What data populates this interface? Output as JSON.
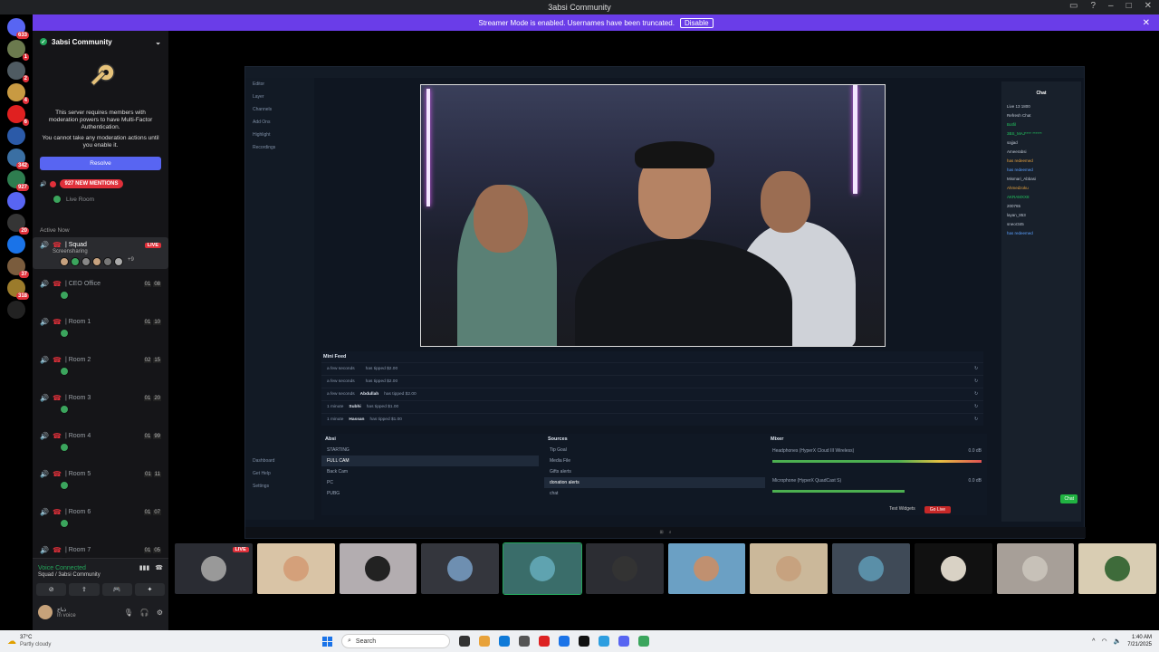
{
  "window": {
    "title": "3absi Community"
  },
  "banner": {
    "text": "Streamer Mode is enabled. Usernames have been truncated.",
    "disable_label": "Disable"
  },
  "guilds": [
    {
      "badge": "633",
      "color": "#5865f2"
    },
    {
      "badge": "1",
      "color": "#6b7a4e"
    },
    {
      "badge": "2",
      "color": "#4f5b62"
    },
    {
      "badge": "4",
      "color": "#c89a42"
    },
    {
      "badge": "6",
      "color": "#e02020"
    },
    {
      "badge": "",
      "color": "#2b5aa8"
    },
    {
      "badge": "342",
      "color": "#3a6fa3"
    },
    {
      "badge": "927",
      "color": "#2e7d4f"
    },
    {
      "badge": "",
      "color": "#5865f2"
    },
    {
      "badge": "20",
      "color": "#353535"
    },
    {
      "badge": "",
      "color": "#1a73e8"
    },
    {
      "badge": "37",
      "color": "#7a5c3d"
    },
    {
      "badge": "318",
      "color": "#9b7b2b"
    },
    {
      "badge": "",
      "color": "#222"
    }
  ],
  "server": {
    "name": "3absi Community",
    "mfa_text_1": "This server requires members with moderation powers to have Multi-Factor Authentication.",
    "mfa_text_2": "You cannot take any moderation actions until you enable it.",
    "resolve_label": "Resolve",
    "mentions_label": "927 NEW MENTIONS",
    "live_room": "Live Room",
    "active_now": "Active Now"
  },
  "channels": [
    {
      "name": "| Squad",
      "sub": "Screensharing",
      "live": "LIVE",
      "c1": "",
      "c2": "",
      "more": "+9"
    },
    {
      "name": "| CEO Office",
      "c1": "01",
      "c2": "08"
    },
    {
      "name": "| Room 1",
      "c1": "01",
      "c2": "10"
    },
    {
      "name": "| Room 2",
      "c1": "02",
      "c2": "15"
    },
    {
      "name": "| Room 3",
      "c1": "01",
      "c2": "20"
    },
    {
      "name": "| Room 4",
      "c1": "01",
      "c2": "99"
    },
    {
      "name": "| Room 5",
      "c1": "01",
      "c2": "11"
    },
    {
      "name": "| Room 6",
      "c1": "01",
      "c2": "07"
    },
    {
      "name": "| Room 7",
      "c1": "01",
      "c2": "05"
    }
  ],
  "voice": {
    "status": "Voice Connected",
    "channel": "Squad / 3absi Community",
    "user_name": "ذباح",
    "user_status": "In voice"
  },
  "obs": {
    "menu": [
      "Editor",
      "Layer",
      "Channels",
      "Add Ons",
      "Highlight",
      "Recordings"
    ],
    "minifeed_title": "Mini Feed",
    "feed": [
      {
        "time": "a few seconds",
        "user": "",
        "text": "has tipped $2.00"
      },
      {
        "time": "a few seconds",
        "user": "",
        "text": "has tipped $2.00"
      },
      {
        "time": "a few seconds",
        "user": "Abdullah",
        "text": "has tipped $2.00"
      },
      {
        "time": "1 minute",
        "user": "Subhi",
        "text": "has tipped $1.00"
      },
      {
        "time": "1 minute",
        "user": "Hassan",
        "text": "has tipped $1.00"
      }
    ],
    "scenes_title": "Absi",
    "scenes": [
      "STARTING",
      "FULL CAM",
      "Back Cam",
      "PC",
      "PUBG"
    ],
    "sources_title": "Sources",
    "sources": [
      "Tip Goal",
      "Media File",
      "Gifts alerts",
      "donation alerts",
      "chat"
    ],
    "mixer_title": "Mixer",
    "mixer": [
      {
        "name": "Headphones (HyperX Cloud III Wireless)",
        "db": "0.0 dB"
      },
      {
        "name": "Microphone (HyperX QuadCast S)",
        "db": "0.0 dB"
      }
    ],
    "bottom": [
      "Dashboard",
      "Get Help",
      "Settings"
    ],
    "test_widgets": "Test Widgets",
    "go_live": "Go Live",
    "chat_title": "Chat",
    "chat_btn": "Chat",
    "chat_lines": [
      {
        "t": "Live 13 1800",
        "c": ""
      },
      {
        "t": "Refresh Chat",
        "c": ""
      },
      {
        "t": "Botfil",
        "c": "g"
      },
      {
        "t": "3BS_MAJ**** ******",
        "c": "g"
      },
      {
        "t": "sajjad",
        "c": ""
      },
      {
        "t": "Ameerabsi",
        "c": ""
      },
      {
        "t": "has redeemed",
        "c": "o"
      },
      {
        "t": "has redeemed",
        "c": "b"
      },
      {
        "t": "Mismari_Abbasi",
        "c": ""
      },
      {
        "t": "Ahmedzoku",
        "c": "o"
      },
      {
        "t": "AKRAMXX8",
        "c": "g"
      },
      {
        "t": "200765",
        "c": ""
      },
      {
        "t": "layan_853",
        "c": ""
      },
      {
        "t": "sneor345",
        "c": ""
      },
      {
        "t": "has redeemed",
        "c": "b"
      }
    ]
  },
  "tiles": [
    {
      "color": "#2a2c33",
      "live": "LIVE",
      "face": "#999"
    },
    {
      "color": "#d9c4a6",
      "live": "",
      "face": "#d4a07a"
    },
    {
      "color": "#b3adb0",
      "live": "",
      "face": "#222"
    },
    {
      "color": "#34363d",
      "live": "",
      "face": "#6e8fb1"
    },
    {
      "color": "#3a6d6a",
      "live": "",
      "face": "#5fa3b0"
    },
    {
      "color": "#2c2d33",
      "live": "",
      "face": "#333"
    },
    {
      "color": "#6ba0c4",
      "live": "",
      "face": "#c09070"
    },
    {
      "color": "#cbb89a",
      "live": "",
      "face": "#c7a27f"
    },
    {
      "color": "#3f4a57",
      "live": "",
      "face": "#5a8fa8"
    },
    {
      "color": "#111",
      "live": "",
      "face": "#d9d2c5"
    },
    {
      "color": "#a79f98",
      "live": "",
      "face": "#c7c1b8"
    },
    {
      "color": "#d9cdb3",
      "live": "",
      "face": "#3e6b3a"
    }
  ],
  "taskbar": {
    "weather_temp": "37°C",
    "weather_desc": "Partly cloudy",
    "search": "Search",
    "time": "1:40 AM",
    "date": "7/21/2025"
  }
}
